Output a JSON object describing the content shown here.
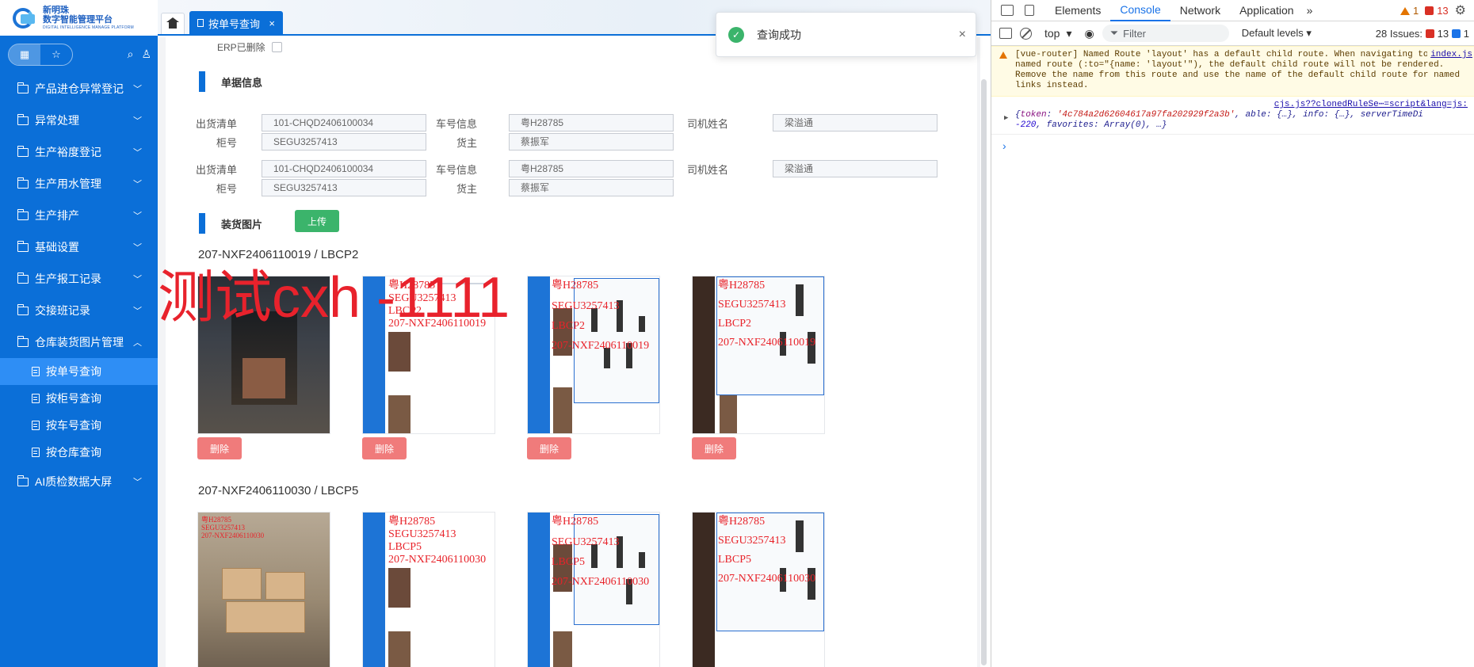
{
  "app": {
    "logo_name": "新明珠",
    "logo_sub": "数字智能管理平台",
    "logo_en": "DIGITAL INTELLIGENCE MANAGE PLATFORM"
  },
  "sidebar": {
    "menu": [
      {
        "label": "产品进仓异常登记",
        "arrow": "down"
      },
      {
        "label": "异常处理",
        "arrow": "down"
      },
      {
        "label": "生产裕度登记",
        "arrow": "down"
      },
      {
        "label": "生产用水管理",
        "arrow": "down"
      },
      {
        "label": "生产排产",
        "arrow": "down"
      },
      {
        "label": "基础设置",
        "arrow": "down"
      },
      {
        "label": "生产报工记录",
        "arrow": "down"
      },
      {
        "label": "交接班记录",
        "arrow": "down"
      },
      {
        "label": "仓库装货图片管理",
        "arrow": "up"
      }
    ],
    "submenu": [
      {
        "label": "按单号查询",
        "active": true
      },
      {
        "label": "按柜号查询",
        "active": false
      },
      {
        "label": "按车号查询",
        "active": false
      },
      {
        "label": "按仓库查询",
        "active": false
      }
    ],
    "last_menu": {
      "label": "AI质检数据大屏",
      "arrow": "down"
    }
  },
  "tabs": {
    "active_label": "按单号查询",
    "close_glyph": "×"
  },
  "toast": {
    "message": "查询成功",
    "close_glyph": "×"
  },
  "content": {
    "erp_label": "ERP已删除",
    "section_doc": "单据信息",
    "section_pics": "装货图片",
    "upload_label": "上传",
    "delete_label": "删除",
    "records": [
      {
        "ship_list_label": "出货清单",
        "ship_list": "101-CHQD2406100034",
        "car_label": "车号信息",
        "car": "粤H28785",
        "driver_label": "司机姓名",
        "driver": "梁溢通",
        "container_label": "柜号",
        "container": "SEGU3257413",
        "owner_label": "货主",
        "owner": "蔡振军"
      },
      {
        "ship_list_label": "出货清单",
        "ship_list": "101-CHQD2406100034",
        "car_label": "车号信息",
        "car": "粤H28785",
        "driver_label": "司机姓名",
        "driver": "梁溢通",
        "container_label": "柜号",
        "container": "SEGU3257413",
        "owner_label": "货主",
        "owner": "蔡振军"
      }
    ],
    "groups": [
      {
        "title": "207-NXF2406110019 / LBCP2",
        "overlay_text": [
          "粤H28785",
          "SEGU3257413",
          "LBCP2",
          "207-NXF2406110019"
        ]
      },
      {
        "title": "207-NXF2406110030 / LBCP5",
        "overlay_text": [
          "粤H28785",
          "SEGU3257413",
          "LBCP5",
          "207-NXF2406110030"
        ]
      }
    ],
    "watermark": "测试cxh -1111"
  },
  "devtools": {
    "tabs": [
      "Elements",
      "Console",
      "Network",
      "Application"
    ],
    "selected_tab": "Console",
    "more": "»",
    "warn_count": "1",
    "error_count": "13",
    "context": "top",
    "filter_placeholder": "Filter",
    "levels": "Default levels",
    "issues_label": "28 Issues:",
    "issues_err": "13",
    "issues_info": "1",
    "warning_text": "[vue-router] Named Route 'layout' has a default child route. When navigating to this named route (:to=\"{name: 'layout'\"), the default child route will not be rendered. Remove the name from this route and use the name of the default child route for named links instead.",
    "warning_source": "index.js",
    "log_source": "cjs.js??clonedRuleSe⋯=script&lang=js:",
    "log_token_key": "token",
    "log_token_val": "'4c784a2d62604617a97fa202929f2a3b'",
    "log_rest": ", able: {…}, info: {…}, serverTimeDi",
    "log_line2_num": "-220",
    "log_line2_rest": ", favorites: Array(0), …}",
    "prompt": "›"
  },
  "colors": {
    "brand_blue": "#0b6fd8",
    "success_green": "#3bb46b",
    "delete_red": "#f07b7b",
    "watermark_red": "#e8222c"
  }
}
